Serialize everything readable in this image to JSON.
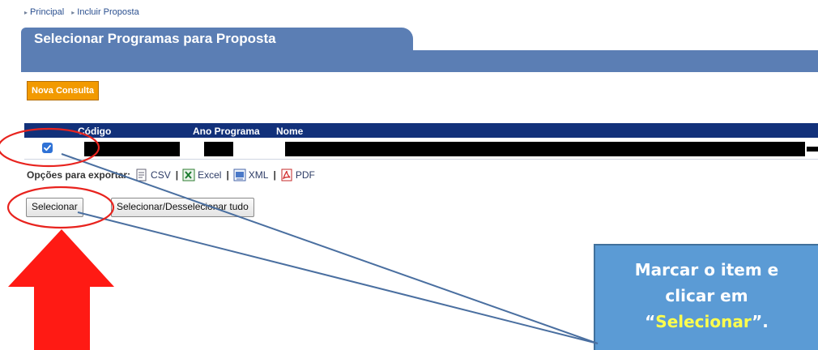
{
  "breadcrumb": {
    "items": [
      "Principal",
      "Incluir Proposta"
    ],
    "separator": "▸"
  },
  "page": {
    "title": "Selecionar Programas para Proposta"
  },
  "actions": {
    "nova_consulta": "Nova Consulta"
  },
  "table": {
    "columns": [
      "Código",
      "Ano Programa",
      "Nome"
    ],
    "rows": [
      {
        "selected": true,
        "codigo": "",
        "ano_programa": "",
        "nome": "",
        "redacted": true
      }
    ]
  },
  "export": {
    "label": "Opções para exportar:",
    "options": [
      {
        "label": "CSV",
        "icon": "csv-file-icon"
      },
      {
        "label": "Excel",
        "icon": "excel-file-icon"
      },
      {
        "label": "XML",
        "icon": "xml-file-icon"
      },
      {
        "label": "PDF",
        "icon": "pdf-file-icon"
      }
    ],
    "separator": "|"
  },
  "buttons": {
    "selecionar": "Selecionar",
    "selecionar_tudo": "Selecionar/Desselecionar tudo"
  },
  "annotation": {
    "line1": "Marcar o item e",
    "line2": "clicar em",
    "quote_open": "“",
    "highlight": "Selecionar",
    "quote_close": "”."
  },
  "colors": {
    "header_band": "#5b7eb4",
    "table_header": "#12317a",
    "nova_consulta": "#f29a00",
    "callout": "#5b9bd5",
    "highlight_text": "#ffff4d",
    "annotation_red": "#e8231e"
  }
}
